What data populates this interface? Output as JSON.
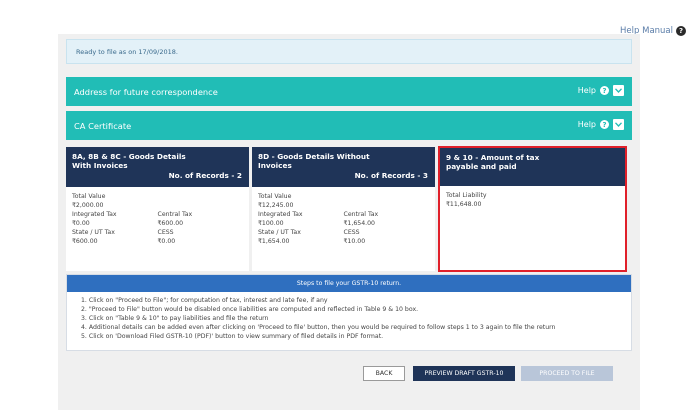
{
  "help_manual": {
    "label": "Help Manual"
  },
  "ready_bar": {
    "text": "Ready to file as on 17/09/2018."
  },
  "sections": [
    {
      "title": "Address for future correspondence",
      "help_label": "Help"
    },
    {
      "title": "CA Certificate",
      "help_label": "Help"
    }
  ],
  "tiles": [
    {
      "title_line1": "8A, 8B & 8C - Goods Details",
      "title_line2": "With Invoices",
      "records": "No. of Records - 2",
      "total_value_label": "Total Value",
      "total_value": "₹2,000.00",
      "f1_label": "Integrated Tax",
      "f1_value": "₹0.00",
      "f2_label": "Central Tax",
      "f2_value": "₹600.00",
      "f3_label": "State / UT Tax",
      "f3_value": "₹600.00",
      "f4_label": "CESS",
      "f4_value": "₹0.00"
    },
    {
      "title_line1": "8D - Goods Details Without",
      "title_line2": "Invoices",
      "records": "No. of Records - 3",
      "total_value_label": "Total Value",
      "total_value": "₹12,245.00",
      "f1_label": "Integrated Tax",
      "f1_value": "₹100.00",
      "f2_label": "Central Tax",
      "f2_value": "₹1,654.00",
      "f3_label": "State / UT Tax",
      "f3_value": "₹1,654.00",
      "f4_label": "CESS",
      "f4_value": "₹10.00"
    },
    {
      "title_line1": "9 & 10 - Amount of tax",
      "title_line2": "payable and paid",
      "total_liability_label": "Total Liability",
      "total_liability_value": "₹11,648.00"
    }
  ],
  "steps": {
    "title": "Steps to file your GSTR-10 return.",
    "items": [
      "1. Click on \"Proceed to File\"; for computation of tax, interest and late fee, if any",
      "2. \"Proceed to File\" button would be disabled once liabilities are computed and reflected in Table 9 & 10 box.",
      "3. Click on \"Table 9 & 10\" to pay liabilities and file the return",
      "4. Additional details can be added even after clicking on 'Proceed to file' button, then you would be required to follow steps 1 to 3 again to file the return",
      "5. Click on 'Download Filed GSTR-10 (PDF)' button to view summary of filed details in PDF format."
    ]
  },
  "buttons": {
    "back": "BACK",
    "preview": "PREVIEW DRAFT GSTR-10",
    "proceed": "PROCEED TO FILE"
  },
  "colors": {
    "teal": "#21bdb6",
    "navy": "#1f3458",
    "highlight_red": "#e0202a",
    "steps_blue": "#2f6fbf"
  }
}
